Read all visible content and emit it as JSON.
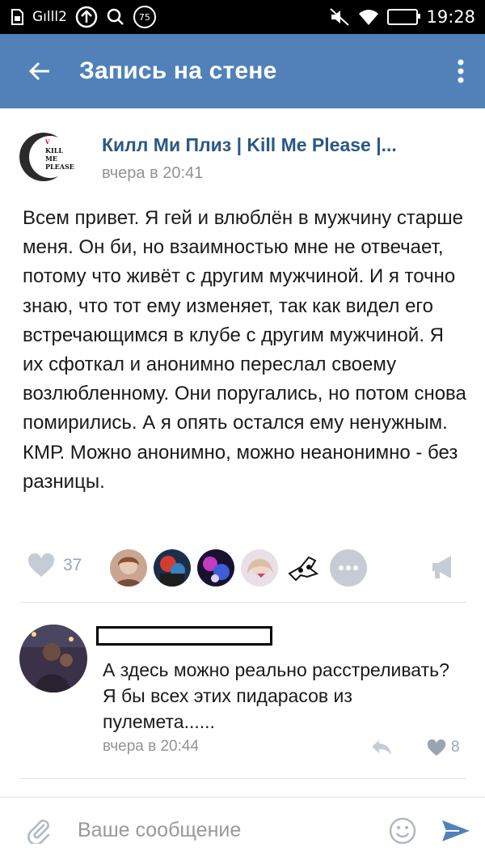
{
  "status_bar": {
    "signal_label": "Gılll2",
    "notification_count": "75",
    "time": "19:28"
  },
  "header": {
    "title": "Запись на стене",
    "back_icon": "arrow-left-icon",
    "menu_icon": "more-vertical-icon"
  },
  "post": {
    "group_name": "Килл Ми Плиз | Kill Me Please |...",
    "avatar_text": [
      "V",
      "KILL",
      "ME",
      "PLEASE"
    ],
    "time": "вчера в 20:41",
    "text": "Всем привет. Я гей и влюблён в мужчину старше меня. Он би, но взаимностью мне не отвечает, потому что живёт с другим мужчиной. И я точно знаю, что тот ему изменяет, так как видел его встречающимся в клубе с другим мужчиной. Я их сфоткал и анонимно переслал своему возлюбленному. Они поругались, но потом снова помирились. А я опять остался ему ненужным. КМР. Можно анонимно, можно неанонимно - без разницы.",
    "likes": "37"
  },
  "comment": {
    "text": "А здесь можно реально расстреливать?Я бы всех этих пидарасов из пулемета......",
    "time": "вчера в 20:44",
    "likes": "8"
  },
  "composer": {
    "placeholder": "Ваше сообщение"
  },
  "colors": {
    "appbar": "#5181b8",
    "link": "#2a5885",
    "muted": "#939393",
    "icon": "#c5ccd5",
    "send": "#5181b8"
  }
}
